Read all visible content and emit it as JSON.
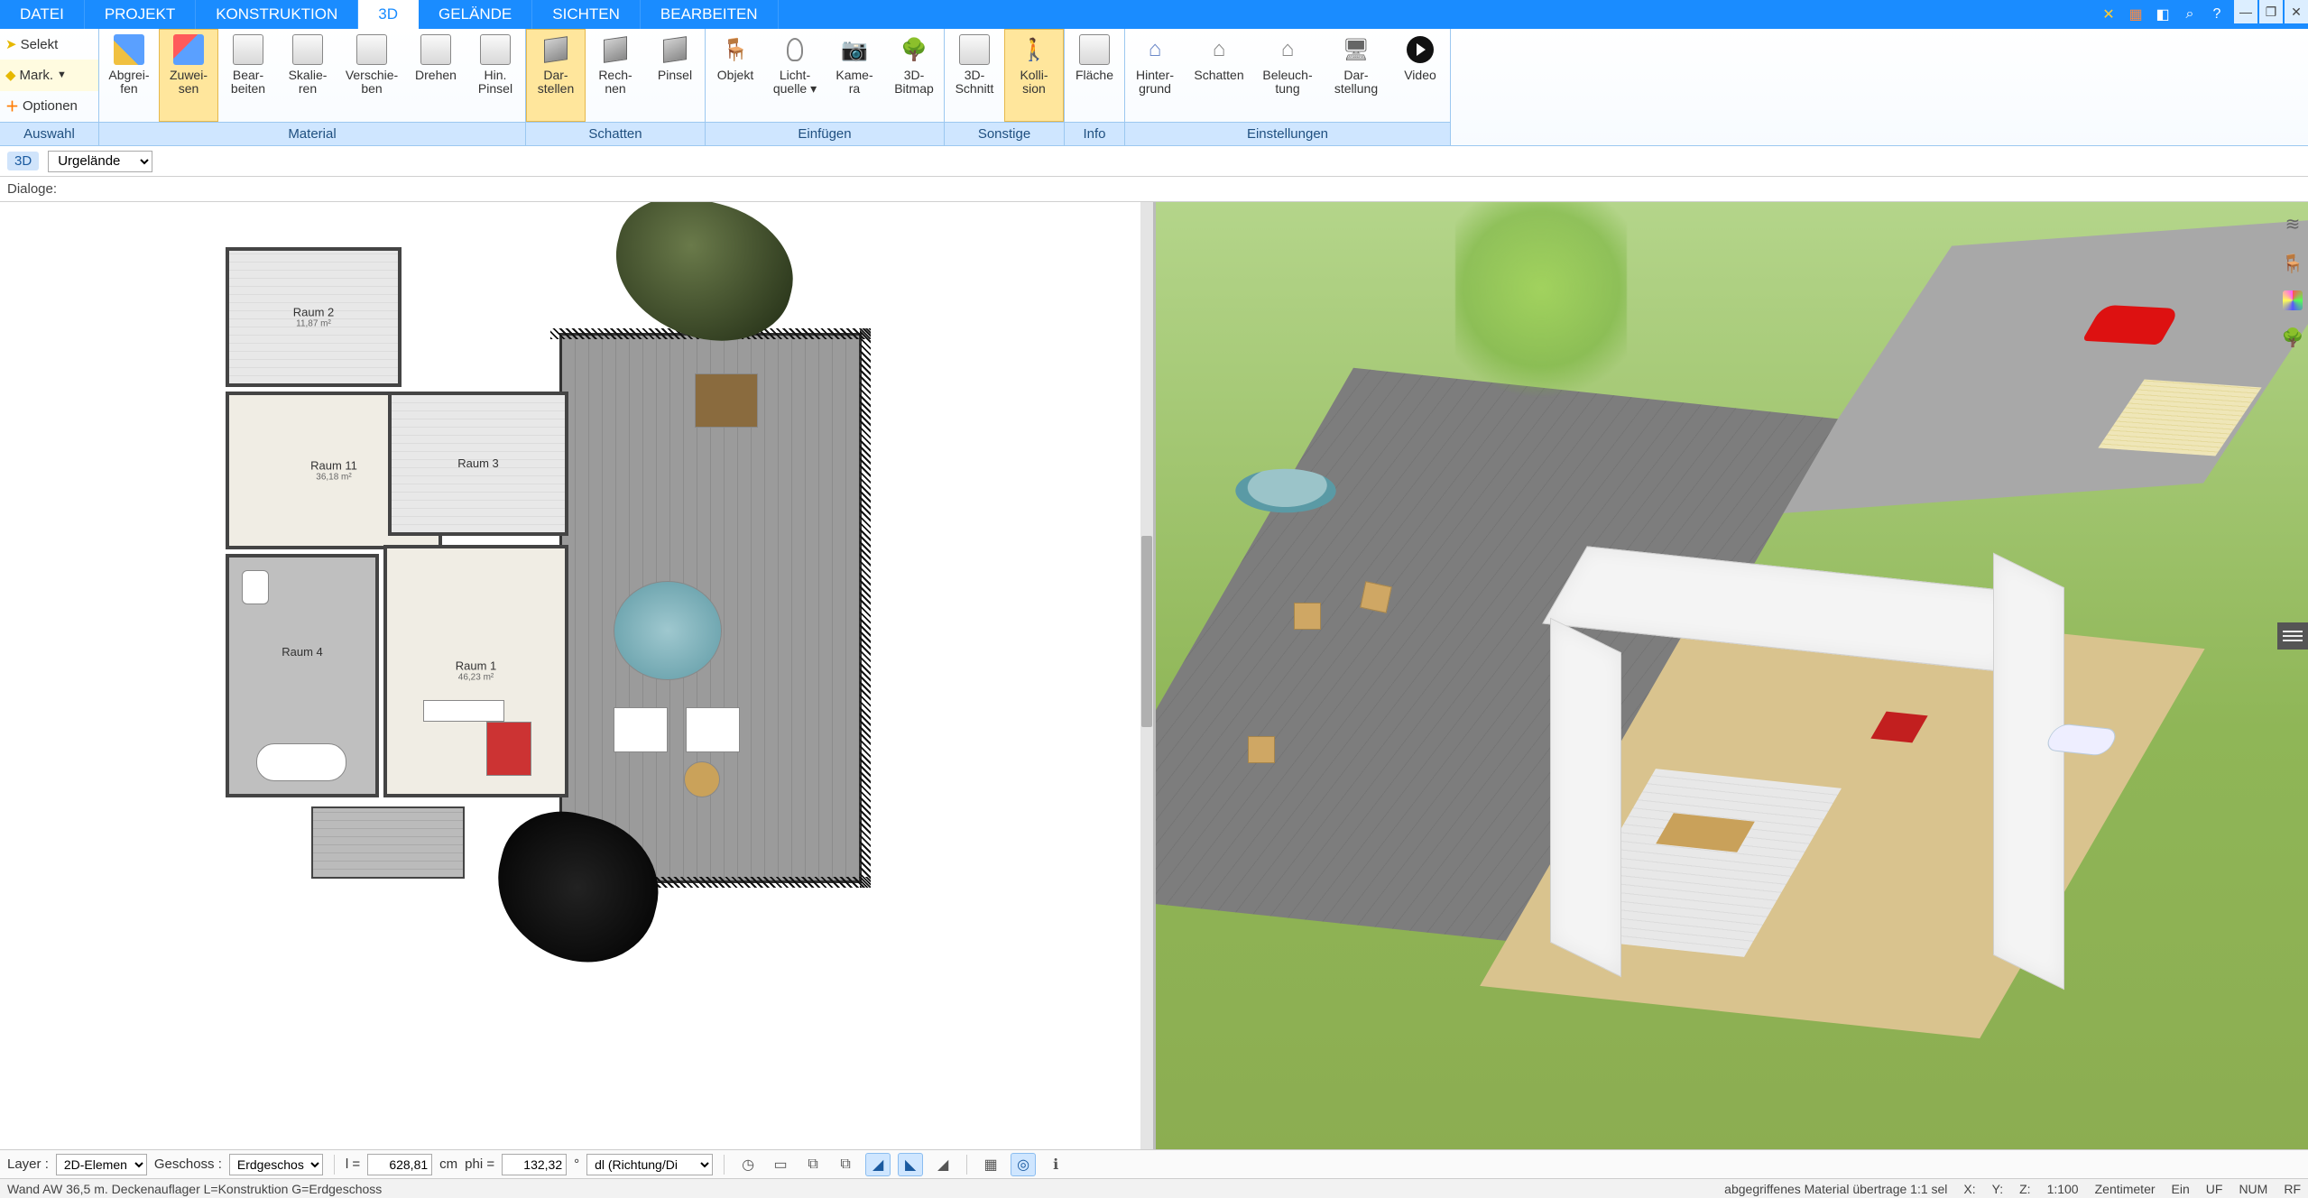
{
  "tabs": {
    "items": [
      "DATEI",
      "PROJEKT",
      "KONSTRUKTION",
      "3D",
      "GELÄNDE",
      "SICHTEN",
      "BEARBEITEN"
    ],
    "active": 3
  },
  "ribbon_left": {
    "selekt": "Selekt",
    "mark": "Mark.",
    "optionen": "Optionen",
    "footer": "Auswahl"
  },
  "groups": {
    "material": {
      "label": "Material",
      "btns": [
        {
          "id": "abgreifen",
          "t1": "Abgrei-",
          "t2": "fen"
        },
        {
          "id": "zuweisen",
          "t1": "Zuwei-",
          "t2": "sen",
          "active": true
        },
        {
          "id": "bearbeiten",
          "t1": "Bear-",
          "t2": "beiten"
        },
        {
          "id": "skalieren",
          "t1": "Skalie-",
          "t2": "ren"
        },
        {
          "id": "verschieben",
          "t1": "Verschie-",
          "t2": "ben"
        },
        {
          "id": "drehen",
          "t1": "Drehen",
          "t2": ""
        },
        {
          "id": "hinpinsel",
          "t1": "Hin.",
          "t2": "Pinsel"
        }
      ]
    },
    "schatten": {
      "label": "Schatten",
      "btns": [
        {
          "id": "darstellen",
          "t1": "Dar-",
          "t2": "stellen",
          "active": true
        },
        {
          "id": "rechnen",
          "t1": "Rech-",
          "t2": "nen"
        },
        {
          "id": "pinsel",
          "t1": "Pinsel",
          "t2": ""
        }
      ]
    },
    "einfuegen": {
      "label": "Einfügen",
      "btns": [
        {
          "id": "objekt",
          "t1": "Objekt",
          "t2": ""
        },
        {
          "id": "lichtquelle",
          "t1": "Licht-",
          "t2": "quelle ▾"
        },
        {
          "id": "kamera",
          "t1": "Kame-",
          "t2": "ra"
        },
        {
          "id": "bitmap3d",
          "t1": "3D-",
          "t2": "Bitmap"
        }
      ]
    },
    "sonstige": {
      "label": "Sonstige",
      "btns": [
        {
          "id": "schnitt3d",
          "t1": "3D-",
          "t2": "Schnitt"
        },
        {
          "id": "kollision",
          "t1": "Kolli-",
          "t2": "sion",
          "active": true
        }
      ]
    },
    "info": {
      "label": "Info",
      "btns": [
        {
          "id": "flaeche",
          "t1": "Fläche",
          "t2": ""
        }
      ]
    },
    "einstellungen": {
      "label": "Einstellungen",
      "btns": [
        {
          "id": "hintergrund",
          "t1": "Hinter-",
          "t2": "grund"
        },
        {
          "id": "schatten2",
          "t1": "Schatten",
          "t2": ""
        },
        {
          "id": "beleuchtung",
          "t1": "Beleuch-",
          "t2": "tung"
        },
        {
          "id": "darstellung",
          "t1": "Dar-",
          "t2": "stellung"
        },
        {
          "id": "video",
          "t1": "Video",
          "t2": ""
        }
      ]
    }
  },
  "ctx": {
    "badge": "3D",
    "selection": "Urgelände"
  },
  "dialog_label": "Dialoge:",
  "rooms": {
    "r2": {
      "name": "Raum 2",
      "area": "11,87 m²"
    },
    "r11": {
      "name": "Raum 11",
      "area": "36,18 m²"
    },
    "r3": {
      "name": "Raum 3",
      "area": ""
    },
    "r4": {
      "name": "Raum 4",
      "area": ""
    },
    "r1": {
      "name": "Raum 1",
      "area": "46,23 m²"
    }
  },
  "bottom": {
    "layer_label": "Layer :",
    "layer_value": "2D-Elemen",
    "geschoss_label": "Geschoss :",
    "geschoss_value": "Erdgeschos",
    "l_label": "l =",
    "l_value": "628,81",
    "l_unit": "cm",
    "phi_label": "phi =",
    "phi_value": "132,32",
    "dl_value": "dl (Richtung/Di"
  },
  "status": {
    "left": "Wand AW 36,5 m. Deckenauflager L=Konstruktion G=Erdgeschoss",
    "mat": "abgegriffenes Material übertrage 1:1 sel",
    "x": "X:",
    "y": "Y:",
    "z": "Z:",
    "scale": "1:100",
    "unit": "Zentimeter",
    "ein": "Ein",
    "uf": "UF",
    "num": "NUM",
    "rf": "RF"
  }
}
